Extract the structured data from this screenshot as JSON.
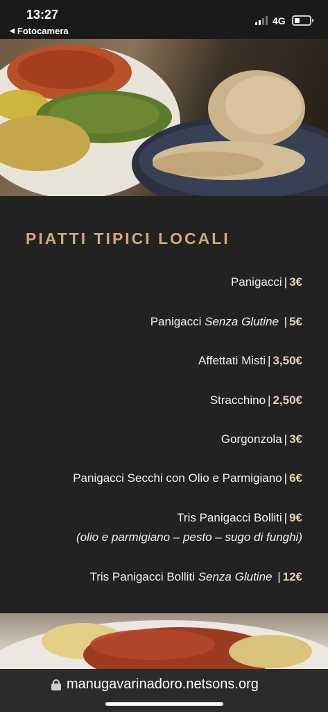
{
  "status_bar": {
    "time": "13:27",
    "back_app": "Fotocamera",
    "network": "4G",
    "icons": [
      "signal-icon",
      "battery-icon"
    ]
  },
  "hero_image": {
    "description_icon": "food-photo"
  },
  "menu": {
    "title": "PIATTI TIPICI LOCALI",
    "items": [
      {
        "name": "Panigacci",
        "italic": "",
        "price": "3€"
      },
      {
        "name": "Panigacci ",
        "italic": "Senza Glutine",
        "price": "5€"
      },
      {
        "name": "Affettati Misti",
        "italic": "",
        "price": "3,50€"
      },
      {
        "name": "Stracchino",
        "italic": "",
        "price": "2,50€"
      },
      {
        "name": "Gorgonzola",
        "italic": "",
        "price": "3€"
      },
      {
        "name": "Panigacci Secchi con Olio e Parmigiano",
        "italic": "",
        "price": "6€"
      },
      {
        "name": "Tris Panigacci Bolliti",
        "italic": "",
        "price": "9€",
        "subtitle": "(olio e parmigiano – pesto – sugo di funghi)"
      },
      {
        "name": "Tris Panigacci Bolliti ",
        "italic": "Senza Glutine",
        "price": "12€"
      }
    ]
  },
  "url_bar": {
    "url": "manugavarinadoro.netsons.org"
  },
  "colors": {
    "accent": "#d1a97a",
    "price": "#e8d2a8",
    "background": "#222222"
  }
}
